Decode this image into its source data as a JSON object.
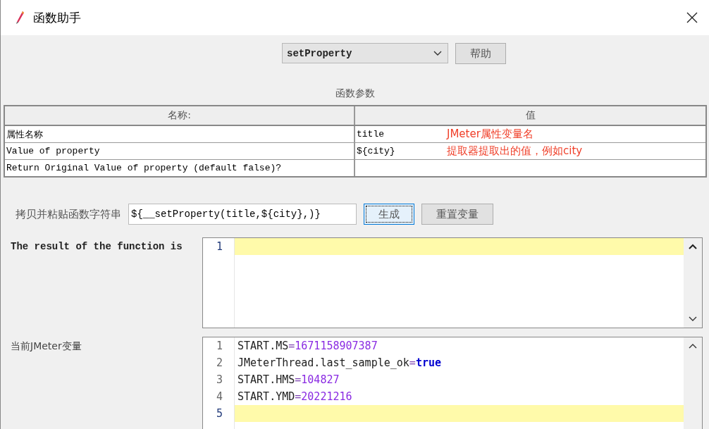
{
  "window": {
    "title": "函数助手"
  },
  "function_select": {
    "value": "setProperty"
  },
  "help_button": "帮助",
  "params_title": "函数参数",
  "table": {
    "columns": [
      "名称:",
      "值"
    ],
    "rows": [
      {
        "name": "属性名称",
        "value": "title",
        "annotation": "JMeter属性变量名"
      },
      {
        "name": "Value of property",
        "value": "${city}",
        "annotation": "提取器提取出的值，例如city"
      },
      {
        "name": "Return Original Value of property (default false)?",
        "value": ""
      }
    ]
  },
  "copy_label": "拷贝并粘贴函数字符串",
  "function_string": {
    "value": "${__setProperty(title,${city},)}"
  },
  "generate_button": {
    "label": "生成",
    "focused": true
  },
  "reset_button": {
    "label": "重置变量",
    "focused": false
  },
  "result": {
    "label": "The result of the function is",
    "lines": [
      {
        "number": "1",
        "current": true
      }
    ]
  },
  "variables": {
    "label": "当前JMeter变量",
    "lines": [
      {
        "number": "1",
        "current": false,
        "parts": [
          {
            "kind": "plain",
            "text": "START.MS"
          },
          {
            "kind": "operator",
            "text": "="
          },
          {
            "kind": "number",
            "text": "1671158907387"
          }
        ]
      },
      {
        "number": "2",
        "current": false,
        "parts": [
          {
            "kind": "plain",
            "text": "JMeterThread.last_sample_ok"
          },
          {
            "kind": "operator",
            "text": "="
          },
          {
            "kind": "keyword",
            "text": "true"
          }
        ]
      },
      {
        "number": "3",
        "current": false,
        "parts": [
          {
            "kind": "plain",
            "text": "START.HMS"
          },
          {
            "kind": "operator",
            "text": "="
          },
          {
            "kind": "number",
            "text": "104827"
          }
        ]
      },
      {
        "number": "4",
        "current": false,
        "parts": [
          {
            "kind": "plain",
            "text": "START.YMD"
          },
          {
            "kind": "operator",
            "text": "="
          },
          {
            "kind": "number",
            "text": "20221216"
          }
        ]
      },
      {
        "number": "5",
        "current": true
      }
    ]
  }
}
